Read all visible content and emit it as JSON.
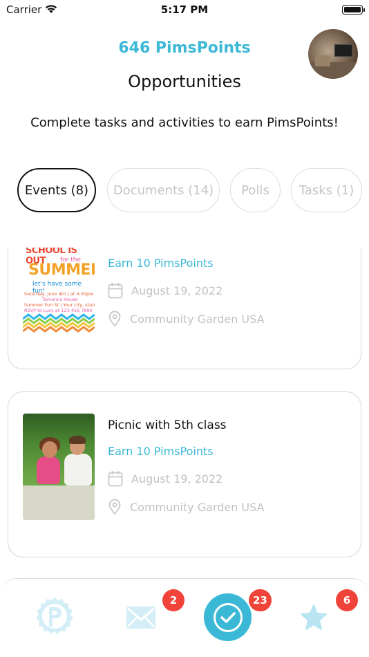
{
  "status_bar": {
    "carrier": "Carrier",
    "time": "5:17 PM"
  },
  "header": {
    "points": "646 PimsPoints",
    "title": "Opportunities",
    "subtitle": "Complete tasks and activities to earn PimsPoints!"
  },
  "tabs": [
    {
      "label": "Events (8)",
      "active": true
    },
    {
      "label": "Documents (14)",
      "active": false
    },
    {
      "label": "Polls",
      "active": false
    },
    {
      "label": "Tasks (1)",
      "active": false
    }
  ],
  "events": [
    {
      "name": "",
      "earn": "Earn 10 PimsPoints",
      "date": "August 19, 2022",
      "location": "Community Garden USA",
      "flyer": {
        "line1": "SCHOOL IS OUT",
        "line2": "for the",
        "line3": "SUMMER",
        "line4": "let's have some fun!",
        "line5": "Saturday, June 4th | at 4:00pm",
        "line6": "Tamara's House",
        "line7": "Summer Fun St | Your city, state",
        "line8": "RSVP to Lucy at 123 456 7890"
      }
    },
    {
      "name": "Picnic with 5th class",
      "earn": "Earn 10 PimsPoints",
      "date": "August 19, 2022",
      "location": "Community Garden USA"
    }
  ],
  "bottom_nav": {
    "messages_badge": "2",
    "opportunities_badge": "23",
    "favorites_badge": "6"
  },
  "colors": {
    "accent": "#3bb8d6",
    "badge": "#f0443a",
    "muted_text": "#c2c2c2",
    "inactive_icon": "#d3eef6"
  }
}
